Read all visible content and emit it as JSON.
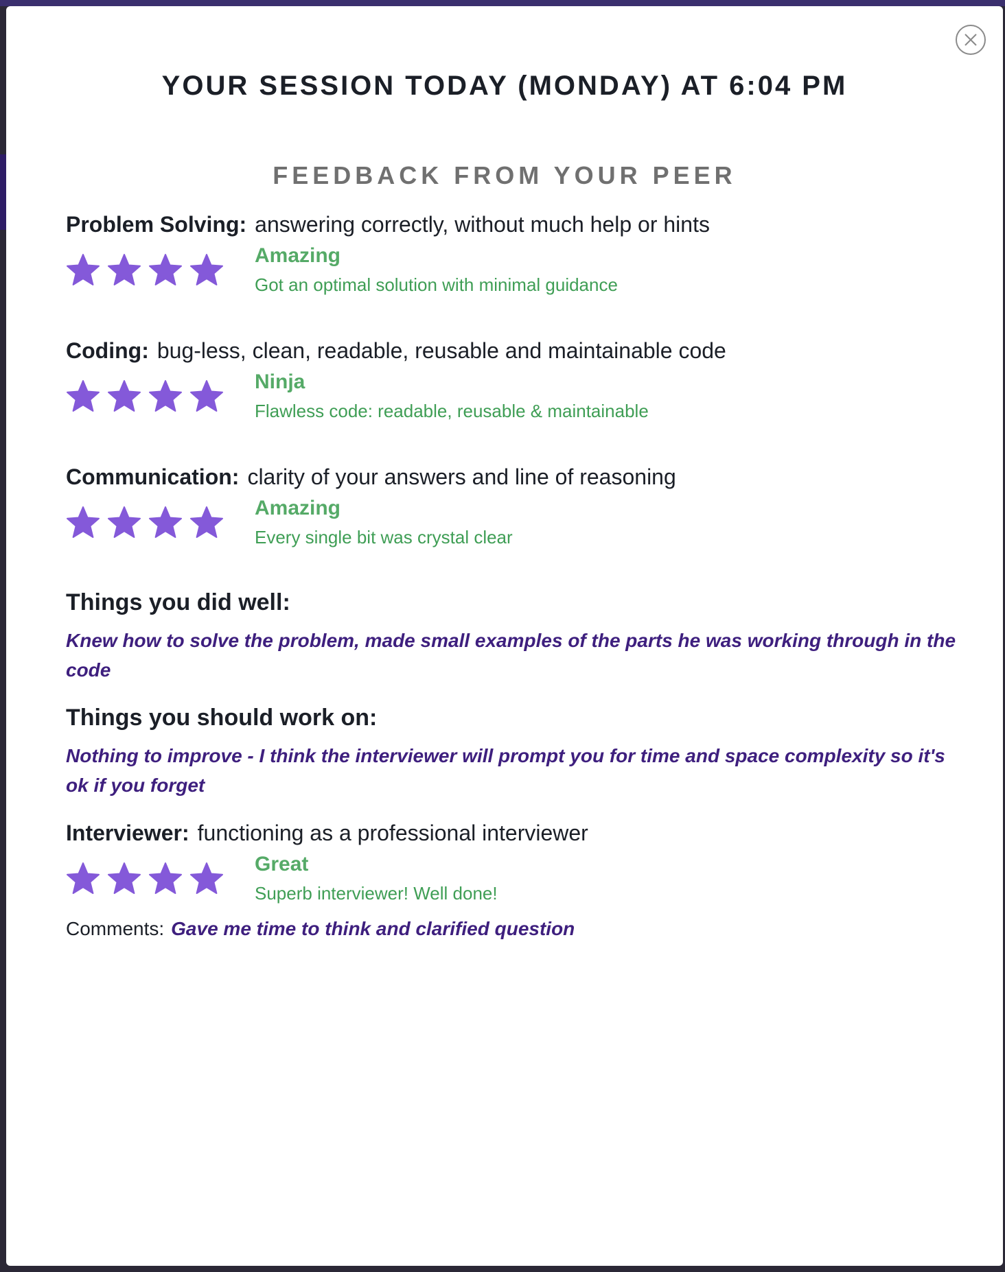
{
  "modal": {
    "title": "YOUR SESSION TODAY (MONDAY) AT 6:04 PM",
    "subtitle": "FEEDBACK FROM YOUR PEER",
    "close_icon": "close-circle-icon"
  },
  "colors": {
    "star": "#8459d9",
    "rating_green": "#55aa67",
    "italic_purple": "#3e1f7e",
    "heading_dark": "#1b1f27",
    "subtitle_gray": "#707070"
  },
  "ratings": [
    {
      "name": "Problem Solving:",
      "criteria": "answering correctly, without much help or hints",
      "stars": 4,
      "level": "Amazing",
      "description": "Got an optimal solution with minimal guidance"
    },
    {
      "name": "Coding:",
      "criteria": "bug-less, clean, readable, reusable and maintainable code",
      "stars": 4,
      "level": "Ninja",
      "description": "Flawless code: readable, reusable & maintainable"
    },
    {
      "name": "Communication:",
      "criteria": "clarity of your answers and line of reasoning",
      "stars": 4,
      "level": "Amazing",
      "description": "Every single bit was crystal clear"
    }
  ],
  "did_well": {
    "heading": "Things you did well:",
    "text": "Knew how to solve the problem, made small examples of the parts he was working through in the code"
  },
  "work_on": {
    "heading": "Things you should work on:",
    "text": "Nothing to improve - I think the interviewer will prompt you for time and space complexity so it's ok if you forget"
  },
  "interviewer": {
    "name": "Interviewer:",
    "criteria": "functioning as a professional interviewer",
    "stars": 4,
    "level": "Great",
    "description": "Superb interviewer! Well done!"
  },
  "comments": {
    "label": "Comments:",
    "text": "Gave me time to think and clarified question"
  }
}
